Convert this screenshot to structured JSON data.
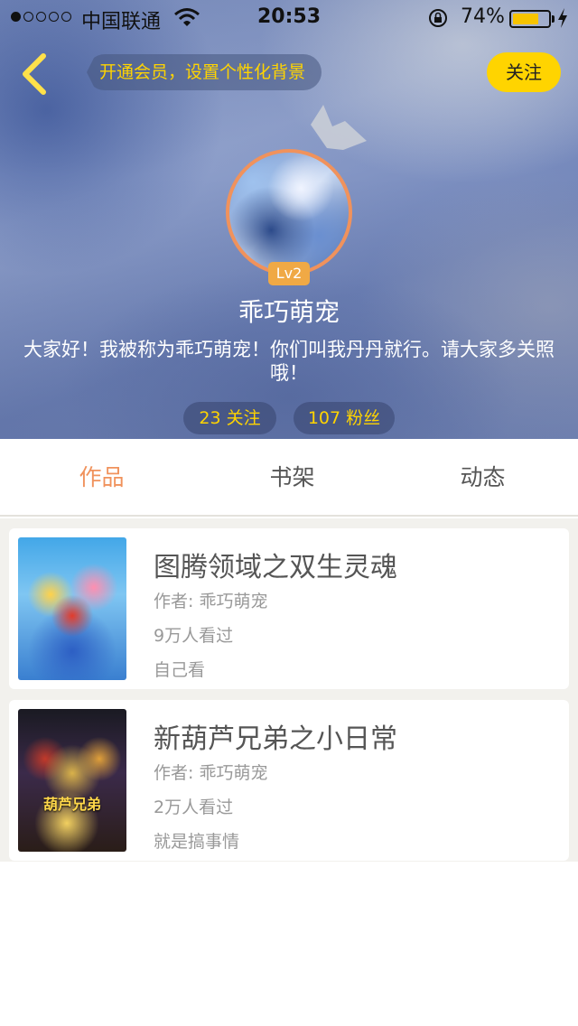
{
  "status_bar": {
    "carrier": "中国联通",
    "time": "20:53",
    "battery_percent": "74%",
    "battery_level": 0.74,
    "signal_bars_filled": 1,
    "signal_bars_total": 5
  },
  "nav": {
    "back_icon": "chevron-left-icon",
    "vip_prompt": "开通会员，设置个性化背景",
    "follow_label": "关注"
  },
  "profile": {
    "level": "Lv2",
    "nickname": "乖巧萌宠",
    "bio": "大家好！我被称为乖巧萌宠！你们叫我丹丹就行。请大家多关照哦！",
    "following": "23 关注",
    "fans": "107 粉丝"
  },
  "tabs": [
    {
      "label": "作品",
      "active": true
    },
    {
      "label": "书架",
      "active": false
    },
    {
      "label": "动态",
      "active": false
    }
  ],
  "works": [
    {
      "title": "图腾领域之双生灵魂",
      "author": "作者: 乖巧萌宠",
      "views": "9万人看过",
      "description": "自己看"
    },
    {
      "title": "新葫芦兄弟之小日常",
      "author": "作者: 乖巧萌宠",
      "views": "2万人看过",
      "description": "就是搞事情",
      "cover_text": "葫芦兄弟"
    }
  ],
  "colors": {
    "accent": "#f0925c",
    "yellow": "#ffd400",
    "level_badge": "#f0a945"
  }
}
